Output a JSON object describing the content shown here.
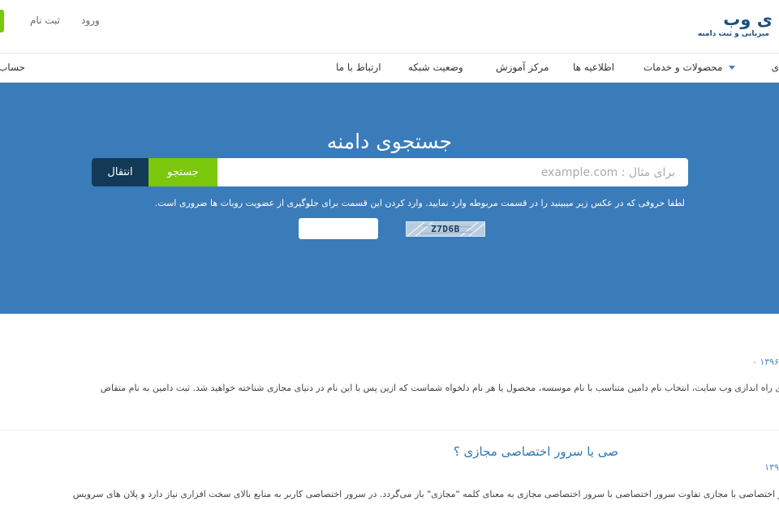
{
  "header": {
    "brand_title": "ی وب",
    "brand_subtitle": "میزبانی و ثبت دامنه",
    "login": "ورود",
    "register": "ثبت نام"
  },
  "nav": {
    "item_cut_right": "ی",
    "products": "محصولات و خدمات",
    "news": "اطلاعیه ها",
    "learning": "مرکز آموزش",
    "network_status": "وضعیت شبکه",
    "contact": "ارتباط با ما",
    "account_cut": "حساب"
  },
  "hero": {
    "title": "جستجوی دامنه",
    "search_placeholder": "برای مثال : example.com",
    "search_button": "جستجو",
    "transfer_button": "انتقال",
    "captcha_hint": "لطفا حروفی که در عکس زیر میبینید را در قسمت مربوطه وارد نمایید. وارد کردن این قسمت برای جلوگیری از عضویت روبات ها ضروری است.",
    "captcha_code": "Z7D6B"
  },
  "posts": [
    {
      "date": "۱۳۹۶ ۰",
      "excerpt": "ی راه اندازی وب سایت، انتخاب نام دامین متناسب با نام موسسه، محصول یا هر نام دلخواه شماست که ازین پس با این نام در دنیای مجازی شناخته خواهید شد. ثبت دامین به نام متقاض"
    },
    {
      "title": "صی یا سرور اختصاصی مجازی ؟",
      "date": "۱۳۹",
      "excerpt": "ر اختصاصی با مجازی تفاوت سرور اختصاصی با سرور اختصاصی مجازی به معنای کلمه \"مجازی\" باز می‌گردد. در سرور اختصاصی کاربر به منابع بالای سخت افزاری نیاز دارد و پلان های سرویس"
    }
  ],
  "colors": {
    "hero_bg": "#3a7bba",
    "accent_green": "#7ac70c",
    "dark_navy": "#123a57",
    "link_blue": "#2f75b5"
  }
}
